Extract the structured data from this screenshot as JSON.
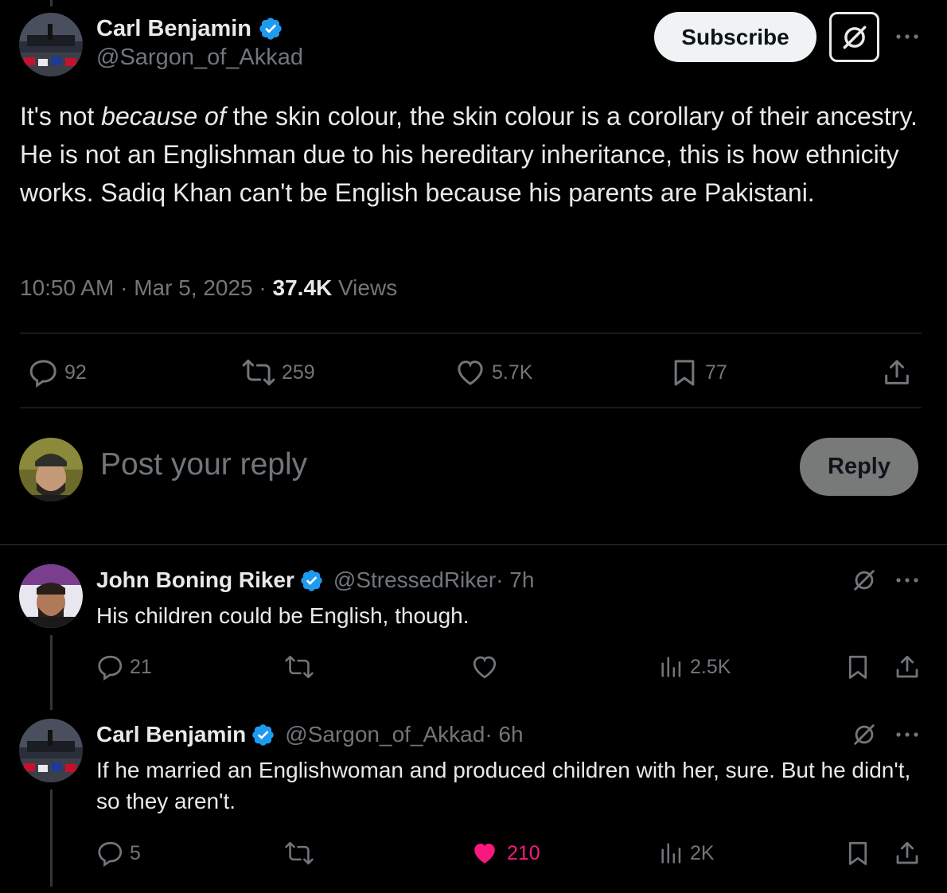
{
  "tweet": {
    "author_name": "Carl Benjamin",
    "author_handle": "@Sargon_of_Akkad",
    "subscribe_label": "Subscribe",
    "text_before_em": "It's not ",
    "text_em": "because of",
    "text_after_em": " the skin colour, the skin colour is a corollary of their ancestry. He is not an Englishman due to his hereditary inheritance, this is how ethnicity works. Sadiq Khan can't be English because his parents are Pakistani.",
    "time": "10:50 AM",
    "separator": " · ",
    "date": "Mar 5, 2025",
    "views_count": "37.4K",
    "views_label": " Views",
    "stats": {
      "replies": "92",
      "reposts": "259",
      "likes": "5.7K",
      "bookmarks": "77"
    }
  },
  "composer": {
    "placeholder": "Post your reply",
    "reply_label": "Reply"
  },
  "replies": [
    {
      "author_name": "John Boning Riker",
      "author_handle": "@StressedRiker",
      "age": " · 7h",
      "text": "His children could be English, though.",
      "replies": "21",
      "reposts": "",
      "likes": "",
      "views": "2.5K",
      "liked": false
    },
    {
      "author_name": "Carl Benjamin",
      "author_handle": "@Sargon_of_Akkad",
      "age": " · 6h",
      "text": "If he married an Englishwoman and produced children with her, sure. But he didn't, so they aren't.",
      "replies": "5",
      "reposts": "",
      "likes": "210",
      "views": "2K",
      "liked": true
    }
  ],
  "colors": {
    "background": "#000000",
    "text_primary": "#e7e9ea",
    "text_secondary": "#71767b",
    "verified_blue": "#1d9bf0",
    "like_pink": "#f91880",
    "divider": "#2f3336"
  },
  "icons": [
    "verified-badge-icon",
    "grok-icon",
    "more-icon",
    "reply-icon",
    "repost-icon",
    "like-icon",
    "bookmark-icon",
    "share-icon",
    "views-icon"
  ]
}
